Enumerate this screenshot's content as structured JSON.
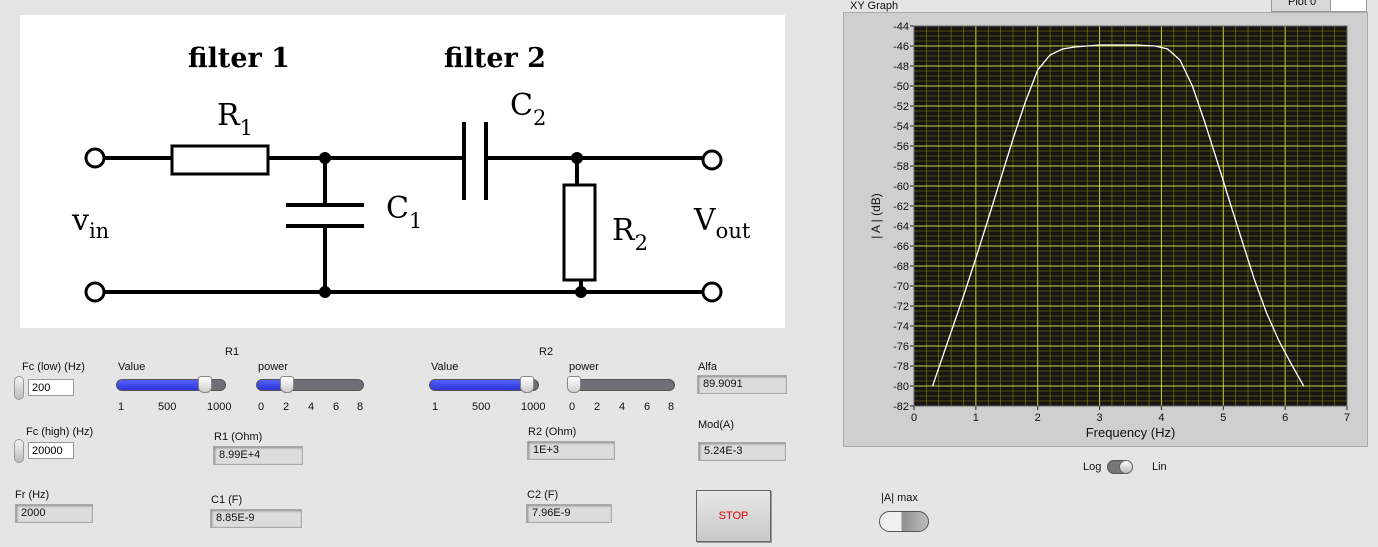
{
  "schematic": {
    "filter1": "filter 1",
    "filter2": "filter 2",
    "r1": "R",
    "r1_sub": "1",
    "c1": "C",
    "c1_sub": "1",
    "c2": "C",
    "c2_sub": "2",
    "r2": "R",
    "r2_sub": "2",
    "vin": "v",
    "vin_sub": "in",
    "vout": "V",
    "vout_sub": "out"
  },
  "fc_low": {
    "label": "Fc (low) (Hz)",
    "value": "200"
  },
  "fc_high": {
    "label": "Fc (high) (Hz)",
    "value": "20000"
  },
  "fr": {
    "label": "Fr (Hz)",
    "value": "2000"
  },
  "r1_group": {
    "title": "R1",
    "value_label": "Value",
    "value_ticks": [
      "1",
      "500",
      "1000"
    ],
    "value_fraction": 0.85,
    "power_label": "power",
    "power_ticks": [
      "0",
      "2",
      "4",
      "6",
      "8"
    ],
    "power_fraction": 0.25
  },
  "r2_group": {
    "title": "R2",
    "value_label": "Value",
    "value_ticks": [
      "1",
      "500",
      "1000"
    ],
    "value_fraction": 0.95,
    "power_label": "power",
    "power_ticks": [
      "0",
      "2",
      "4",
      "6",
      "8"
    ],
    "power_fraction": 0.0
  },
  "r1_ohm": {
    "label": "R1 (Ohm)",
    "value": "8.99E+4"
  },
  "c1_f": {
    "label": "C1 (F)",
    "value": "8.85E-9"
  },
  "r2_ohm": {
    "label": "R2 (Ohm)",
    "value": "1E+3"
  },
  "c2_f": {
    "label": "C2 (F)",
    "value": "7.96E-9"
  },
  "alfa": {
    "label": "Alfa",
    "value": "89.9091"
  },
  "moda": {
    "label": "Mod(A)",
    "value": "5.24E-3"
  },
  "stop_button": "STOP",
  "log_lin": {
    "left": "Log",
    "right": "Lin"
  },
  "amax": {
    "label": "|A| max"
  },
  "graph": {
    "title": "XY Graph",
    "plot_legend": "Plot 0",
    "colors": {
      "background": "#151515",
      "grid": "#858500",
      "major_grid": "#d2d23a",
      "curve": "#ffffff"
    }
  },
  "chart_data": {
    "type": "line",
    "xlabel": "Frequency (Hz)",
    "ylabel": "| A | (dB)",
    "xlim": [
      0,
      7
    ],
    "ylim": [
      -82,
      -44
    ],
    "x_ticks": [
      "0",
      "1",
      "2",
      "3",
      "4",
      "5",
      "6",
      "7"
    ],
    "y_ticks": [
      "-44",
      "-46",
      "-48",
      "-50",
      "-52",
      "-54",
      "-56",
      "-58",
      "-60",
      "-62",
      "-64",
      "-66",
      "-68",
      "-70",
      "-72",
      "-74",
      "-76",
      "-78",
      "-80",
      "-82"
    ],
    "grid": true,
    "series": [
      {
        "x": [
          0.3,
          0.5,
          0.8,
          1.0,
          1.2,
          1.4,
          1.6,
          1.8,
          2.0,
          2.2,
          2.4,
          2.6,
          2.8,
          3.0,
          3.3,
          3.6,
          3.9,
          4.1,
          4.3,
          4.5,
          4.7,
          4.9,
          5.1,
          5.3,
          5.5,
          5.7,
          5.9,
          6.1,
          6.3
        ],
        "y": [
          -80,
          -76.4,
          -71,
          -67.2,
          -63.3,
          -59.3,
          -55.3,
          -51.6,
          -48.4,
          -46.9,
          -46.3,
          -46.1,
          -46.0,
          -45.9,
          -45.9,
          -45.9,
          -46.0,
          -46.3,
          -47.4,
          -50.0,
          -53.6,
          -57.5,
          -61.5,
          -65.4,
          -69.3,
          -72.7,
          -75.5,
          -77.8,
          -80
        ]
      }
    ]
  }
}
